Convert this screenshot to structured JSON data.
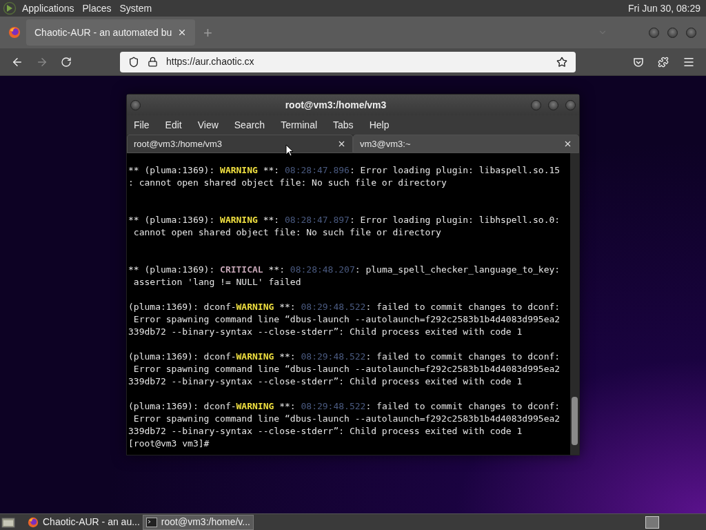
{
  "top_panel": {
    "menus": [
      "Applications",
      "Places",
      "System"
    ],
    "clock": "Fri Jun 30, 08:29"
  },
  "browser": {
    "tabs": [
      {
        "title": "Chaotic-AUR - an automated bu",
        "selected": true
      }
    ],
    "new_tab": "+",
    "url": "https://aur.chaotic.cx"
  },
  "terminal": {
    "title": "root@vm3:/home/vm3",
    "menus": [
      "File",
      "Edit",
      "View",
      "Search",
      "Terminal",
      "Tabs",
      "Help"
    ],
    "tabs": [
      {
        "label": "root@vm3:/home/vm3",
        "selected": true
      },
      {
        "label": "vm3@vm3:~",
        "selected": false
      }
    ],
    "messages": [
      {
        "kind": "wide",
        "lines": [
          [
            {
              "kind": "text",
              "text": "** (pluma:1369): "
            },
            {
              "kind": "warning",
              "text": "WARNING"
            },
            {
              "kind": "text",
              "text": " **: "
            },
            {
              "kind": "time",
              "text": "08:28:47.896"
            },
            {
              "kind": "text",
              "text": ": Error loading plugin: libaspell.so.15"
            }
          ],
          [
            {
              "kind": "text",
              "text": ": cannot open shared object file: No such file or directory"
            }
          ]
        ]
      },
      {
        "kind": "wide",
        "lines": [
          [
            {
              "kind": "text",
              "text": "** (pluma:1369): "
            },
            {
              "kind": "warning",
              "text": "WARNING"
            },
            {
              "kind": "text",
              "text": " **: "
            },
            {
              "kind": "time",
              "text": "08:28:47.897"
            },
            {
              "kind": "text",
              "text": ": Error loading plugin: libhspell.so.0:"
            }
          ],
          [
            {
              "kind": "text",
              "text": " cannot open shared object file: No such file or directory"
            }
          ]
        ]
      },
      {
        "kind": "tight",
        "lines": [
          [
            {
              "kind": "text",
              "text": "** (pluma:1369): "
            },
            {
              "kind": "critical",
              "text": "CRITICAL"
            },
            {
              "kind": "text",
              "text": " **: "
            },
            {
              "kind": "time",
              "text": "08:28:48.207"
            },
            {
              "kind": "text",
              "text": ": pluma_spell_checker_language_to_key:"
            }
          ],
          [
            {
              "kind": "text",
              "text": " assertion 'lang != NULL' failed"
            }
          ]
        ]
      },
      {
        "kind": "tight",
        "lines": [
          [
            {
              "kind": "text",
              "text": "(pluma:1369): dconf-"
            },
            {
              "kind": "warning",
              "text": "WARNING"
            },
            {
              "kind": "text",
              "text": " **: "
            },
            {
              "kind": "time",
              "text": "08:29:48.522"
            },
            {
              "kind": "text",
              "text": ": failed to commit changes to dconf:"
            }
          ],
          [
            {
              "kind": "text",
              "text": " Error spawning command line “dbus-launch --autolaunch=f292c2583b1b4d4083d995ea2"
            }
          ],
          [
            {
              "kind": "text",
              "text": "339db72 --binary-syntax --close-stderr”: Child process exited with code 1"
            }
          ]
        ]
      },
      {
        "kind": "tight",
        "lines": [
          [
            {
              "kind": "text",
              "text": "(pluma:1369): dconf-"
            },
            {
              "kind": "warning",
              "text": "WARNING"
            },
            {
              "kind": "text",
              "text": " **: "
            },
            {
              "kind": "time",
              "text": "08:29:48.522"
            },
            {
              "kind": "text",
              "text": ": failed to commit changes to dconf:"
            }
          ],
          [
            {
              "kind": "text",
              "text": " Error spawning command line “dbus-launch --autolaunch=f292c2583b1b4d4083d995ea2"
            }
          ],
          [
            {
              "kind": "text",
              "text": "339db72 --binary-syntax --close-stderr”: Child process exited with code 1"
            }
          ]
        ]
      },
      {
        "kind": "last",
        "lines": [
          [
            {
              "kind": "text",
              "text": "(pluma:1369): dconf-"
            },
            {
              "kind": "warning",
              "text": "WARNING"
            },
            {
              "kind": "text",
              "text": " **: "
            },
            {
              "kind": "time",
              "text": "08:29:48.522"
            },
            {
              "kind": "text",
              "text": ": failed to commit changes to dconf:"
            }
          ],
          [
            {
              "kind": "text",
              "text": " Error spawning command line “dbus-launch --autolaunch=f292c2583b1b4d4083d995ea2"
            }
          ],
          [
            {
              "kind": "text",
              "text": "339db72 --binary-syntax --close-stderr”: Child process exited with code 1"
            }
          ]
        ]
      }
    ],
    "prompt": "[root@vm3 vm3]#"
  },
  "taskbar": {
    "tasks": [
      {
        "kind": "browser",
        "label": "Chaotic-AUR - an au...",
        "selected": false
      },
      {
        "kind": "terminal",
        "label": "root@vm3:/home/v...",
        "selected": true
      }
    ]
  }
}
